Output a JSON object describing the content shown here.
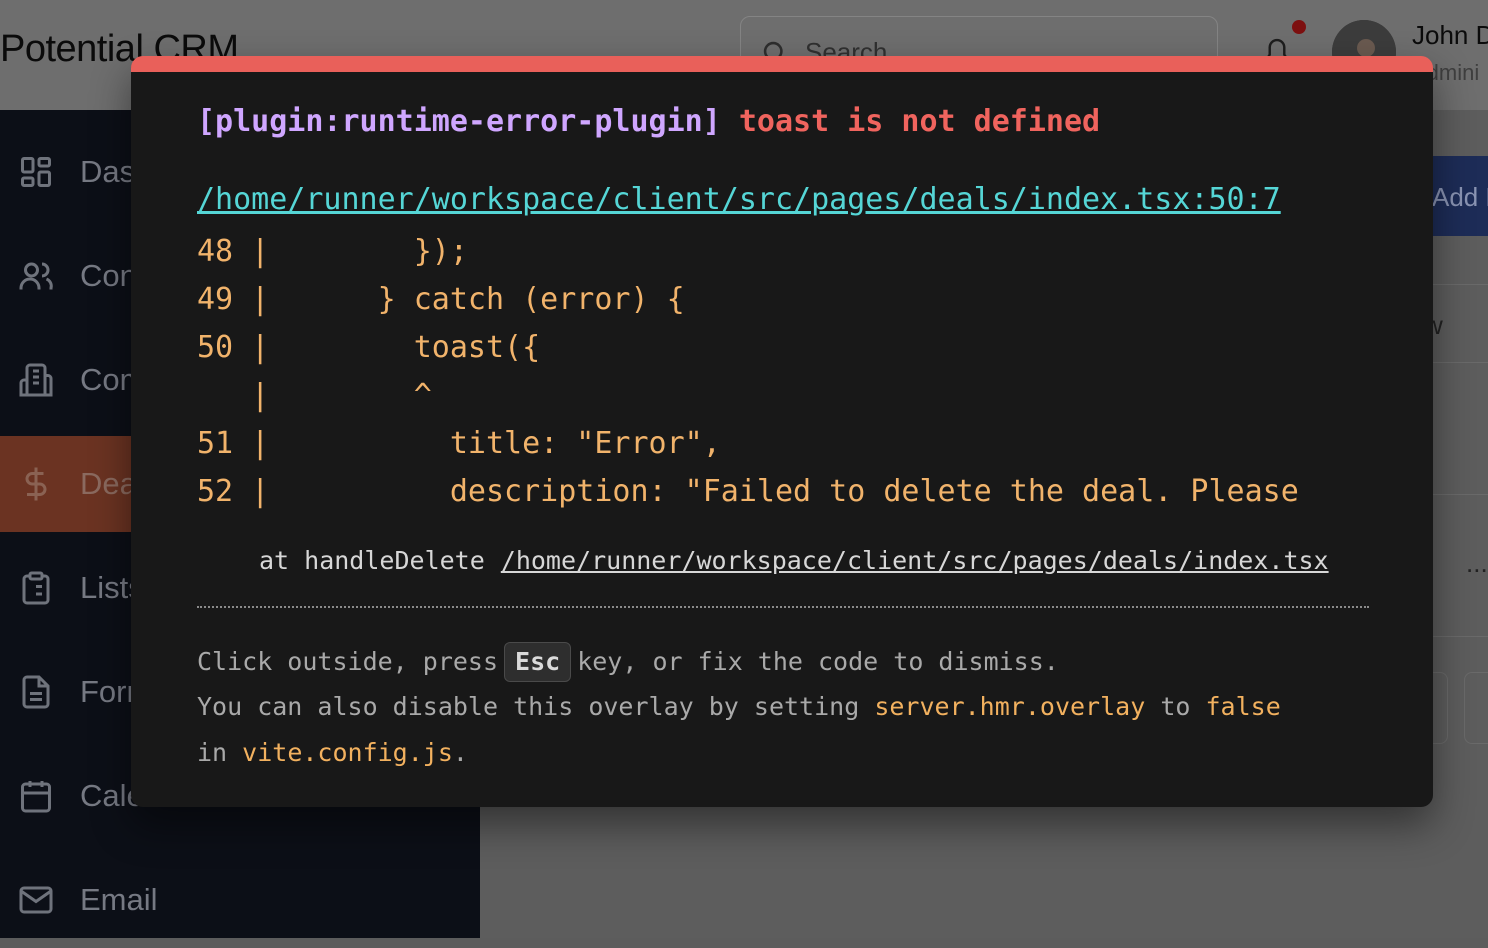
{
  "app": {
    "brand": "Potential CRM",
    "search_placeholder": "Search",
    "user_name": "John D",
    "user_role": "Admini"
  },
  "sidebar": {
    "items": [
      {
        "label": "Dashboard",
        "icon": "dashboard-icon"
      },
      {
        "label": "Contacts",
        "icon": "users-icon"
      },
      {
        "label": "Companies",
        "icon": "building-icon"
      },
      {
        "label": "Deals",
        "icon": "dollar-icon",
        "active": true
      },
      {
        "label": "Lists",
        "icon": "clipboard-icon"
      },
      {
        "label": "Forms",
        "icon": "file-text-icon"
      },
      {
        "label": "Calendar",
        "icon": "calendar-icon"
      },
      {
        "label": "Email",
        "icon": "mail-icon"
      }
    ]
  },
  "content": {
    "add_button": "Add Deal",
    "view_fragment": "w",
    "more_fragment": "..."
  },
  "overlay": {
    "plugin": "[plugin:runtime-error-plugin]",
    "message": "toast is not defined",
    "file": "/home/runner/workspace/client/src/pages/deals/index.tsx:50:7",
    "code_lines": [
      "48 |        });",
      "49 |      } catch (error) {",
      "50 |        toast({",
      "   |        ^",
      "51 |          title: \"Error\",",
      "52 |          description: \"Failed to delete the deal. Please"
    ],
    "stack_prefix": "at handleDelete",
    "stack_link": "/home/runner/workspace/client/src/pages/deals/index.tsx",
    "tip1_a": "Click outside, press",
    "tip1_key": "Esc",
    "tip1_b": "key, or fix the code to dismiss.",
    "tip2_a": "You can also disable this overlay by setting",
    "tip2_code": "server.hmr.overlay",
    "tip2_b": "to",
    "tip2_false": "false",
    "tip3_a": "in",
    "tip3_code": "vite.config.js",
    "tip3_b": "."
  },
  "colors": {
    "overlay_bg": "#181818",
    "overlay_border": "#e9605a",
    "plugin": "#cfa6ff",
    "error": "#f0645e",
    "file_link": "#55d6d6",
    "code": "#f1b36b"
  }
}
